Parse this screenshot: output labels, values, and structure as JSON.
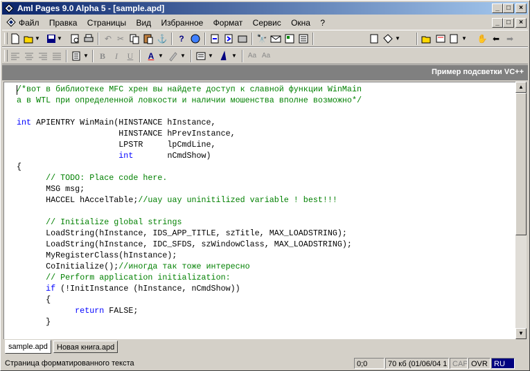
{
  "window": {
    "title": "Aml Pages 9.0 Alpha 5 - [sample.apd]",
    "min_glyph": "_",
    "max_glyph": "□",
    "close_glyph": "×"
  },
  "menu": {
    "items": [
      "Файл",
      "Правка",
      "Страницы",
      "Вид",
      "Избранное",
      "Формат",
      "Сервис",
      "Окна",
      "?"
    ]
  },
  "toolbar2": {
    "bold": "B",
    "italic": "I",
    "underline": "U",
    "font_color": "A"
  },
  "doc": {
    "header_title": "Пример подсветки VC++"
  },
  "code": [
    [
      {
        "t": "/*вот в библиотеке MFC хрен вы найдете доступ к славной функции WinMain",
        "c": "com"
      }
    ],
    [
      {
        "t": "а в WTL при определенной ловкости и наличии мошенства вполне возможно*/",
        "c": "com"
      }
    ],
    [],
    [
      {
        "t": "int",
        "c": "kw"
      },
      {
        "t": " APIENTRY WinMain(HINSTANCE hInstance,",
        "c": "txt"
      }
    ],
    [
      {
        "t": "                     HINSTANCE hPrevInstance,",
        "c": "txt"
      }
    ],
    [
      {
        "t": "                     LPSTR     lpCmdLine,",
        "c": "txt"
      }
    ],
    [
      {
        "t": "                     ",
        "c": "txt"
      },
      {
        "t": "int",
        "c": "kw"
      },
      {
        "t": "       nCmdShow)",
        "c": "txt"
      }
    ],
    [
      {
        "t": "{",
        "c": "txt"
      }
    ],
    [
      {
        "t": "      ",
        "c": "txt"
      },
      {
        "t": "// TODO: Place code here.",
        "c": "com"
      }
    ],
    [
      {
        "t": "      MSG msg;",
        "c": "txt"
      }
    ],
    [
      {
        "t": "      HACCEL hAccelTable;",
        "c": "txt"
      },
      {
        "t": "//uay uay uninitilized variable ! best!!!",
        "c": "com"
      }
    ],
    [],
    [
      {
        "t": "      ",
        "c": "txt"
      },
      {
        "t": "// Initialize global strings",
        "c": "com"
      }
    ],
    [
      {
        "t": "      LoadString(hInstance, IDS_APP_TITLE, szTitle, MAX_LOADSTRING);",
        "c": "txt"
      }
    ],
    [
      {
        "t": "      LoadString(hInstance, IDC_SFDS, szWindowClass, MAX_LOADSTRING);",
        "c": "txt"
      }
    ],
    [
      {
        "t": "      MyRegisterClass(hInstance);",
        "c": "txt"
      }
    ],
    [
      {
        "t": "      CoInitialize();",
        "c": "txt"
      },
      {
        "t": "//иногда так тоже интересно",
        "c": "com"
      }
    ],
    [
      {
        "t": "      ",
        "c": "txt"
      },
      {
        "t": "// Perform application initialization:",
        "c": "com"
      }
    ],
    [
      {
        "t": "      ",
        "c": "txt"
      },
      {
        "t": "if",
        "c": "kw"
      },
      {
        "t": " (!InitInstance (hInstance, nCmdShow))",
        "c": "txt"
      }
    ],
    [
      {
        "t": "      {",
        "c": "txt"
      }
    ],
    [
      {
        "t": "            ",
        "c": "txt"
      },
      {
        "t": "return",
        "c": "kw"
      },
      {
        "t": " FALSE;",
        "c": "txt"
      }
    ],
    [
      {
        "t": "      }",
        "c": "txt"
      }
    ]
  ],
  "tabs": [
    "sample.apd",
    "Новая книга.apd"
  ],
  "status": {
    "message": "Страница форматированного текста",
    "position": "0;0",
    "info": "70 кб (01/06/04 1",
    "cap": "CAP",
    "ovr": "OVR",
    "lang": "RU"
  },
  "colors": {
    "comment": "#008000",
    "keyword": "#0000ff",
    "title_start": "#0a246a",
    "title_end": "#a6caf0"
  }
}
